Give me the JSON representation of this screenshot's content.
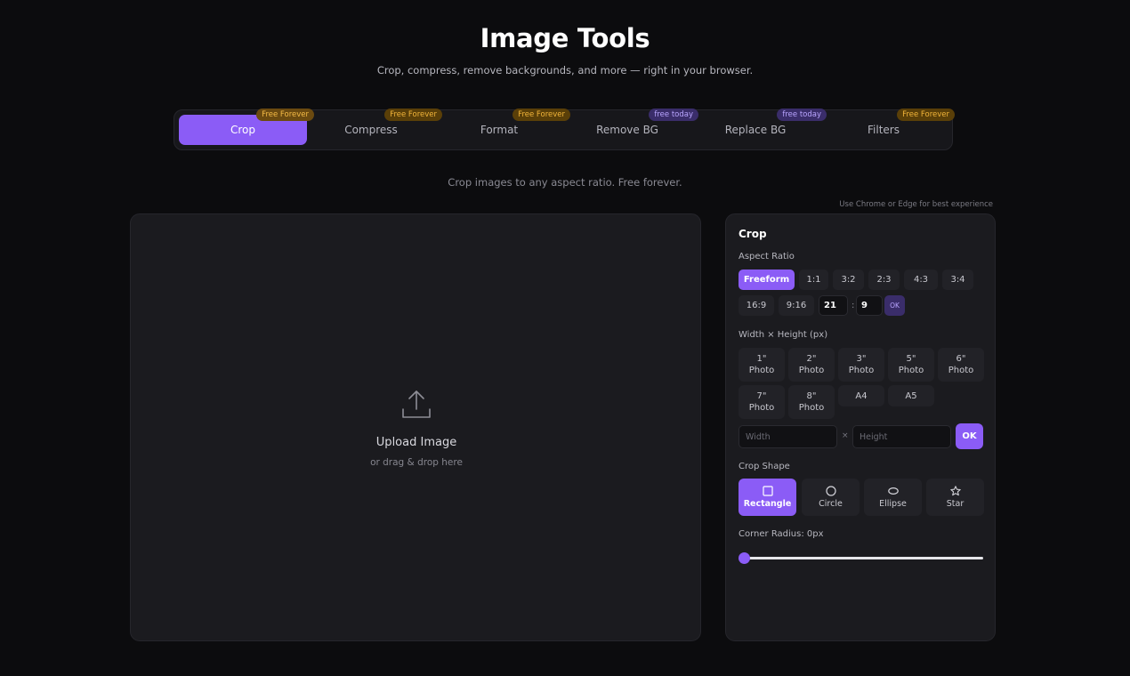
{
  "header": {
    "title": "Image Tools",
    "subtitle": "Crop, compress, remove backgrounds, and more — right in your browser."
  },
  "tabs": [
    {
      "label": "Crop",
      "badge": "Free Forever",
      "badge_type": "forever",
      "active": true
    },
    {
      "label": "Compress",
      "badge": "Free Forever",
      "badge_type": "forever"
    },
    {
      "label": "Format",
      "badge": "Free Forever",
      "badge_type": "forever"
    },
    {
      "label": "Remove BG",
      "badge": "free today",
      "badge_type": "today"
    },
    {
      "label": "Replace BG",
      "badge": "free today",
      "badge_type": "today"
    },
    {
      "label": "Filters",
      "badge": "Free Forever",
      "badge_type": "forever"
    }
  ],
  "tool_description": "Crop images to any aspect ratio. Free forever.",
  "browser_hint": "Use Chrome or Edge for best experience",
  "upload": {
    "icon": "upload-icon",
    "title": "Upload Image",
    "subtitle": "or drag & drop here"
  },
  "panel": {
    "title": "Crop",
    "aspect_ratio_label": "Aspect Ratio",
    "ratios": [
      "Freeform",
      "1:1",
      "3:2",
      "2:3",
      "4:3",
      "3:4",
      "16:9",
      "9:16"
    ],
    "selected_ratio": "Freeform",
    "custom_ratio": {
      "w": "21",
      "h": "9",
      "separator": ":",
      "ok": "OK"
    },
    "size_label": "Width × Height (px)",
    "sizes": [
      {
        "line1": "1\"",
        "line2": "Photo"
      },
      {
        "line1": "2\"",
        "line2": "Photo"
      },
      {
        "line1": "3\"",
        "line2": "Photo"
      },
      {
        "line1": "5\"",
        "line2": "Photo"
      },
      {
        "line1": "6\"",
        "line2": "Photo"
      },
      {
        "line1": "7\"",
        "line2": "Photo"
      },
      {
        "line1": "8\"",
        "line2": "Photo"
      },
      {
        "line1": "A4",
        "line2": ""
      },
      {
        "line1": "A5",
        "line2": ""
      }
    ],
    "width_placeholder": "Width",
    "height_placeholder": "Height",
    "times": "×",
    "ok": "OK",
    "shape_label": "Crop Shape",
    "shapes": [
      {
        "label": "Rectangle",
        "icon": "square-icon",
        "selected": true
      },
      {
        "label": "Circle",
        "icon": "circle-icon"
      },
      {
        "label": "Ellipse",
        "icon": "ellipse-icon"
      },
      {
        "label": "Star",
        "icon": "star-icon"
      }
    ],
    "corner_radius_label": "Corner Radius: 0px",
    "corner_radius_value": 0
  },
  "colors": {
    "accent": "#8b5cf6",
    "badge_forever_text": "#f2b53a",
    "badge_today_text": "#b9a5ff",
    "background": "#0c0c0e",
    "panel": "#1b1b1f"
  }
}
